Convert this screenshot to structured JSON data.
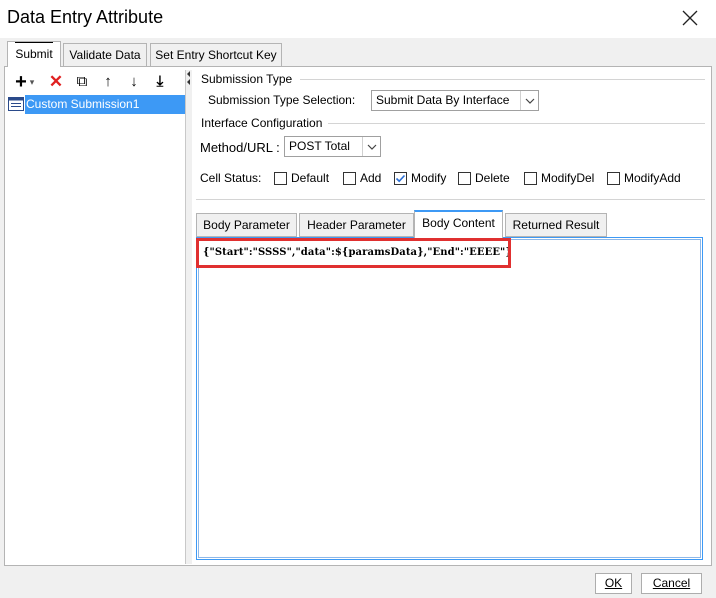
{
  "window": {
    "title": "Data Entry Attribute",
    "close_icon": "close-icon"
  },
  "top_tabs": [
    {
      "label": "Submit",
      "active": true
    },
    {
      "label": "Validate Data",
      "active": false
    },
    {
      "label": "Set Entry Shortcut Key",
      "active": false
    }
  ],
  "toolbar": {
    "add": "+",
    "add_dropdown": "▾",
    "delete": "✕",
    "copy": "⧉",
    "move_up": "↑",
    "move_down": "↓",
    "move_bottom": "⤓"
  },
  "tree": {
    "items": [
      {
        "label": "Custom Submission1",
        "selected": true
      }
    ]
  },
  "submission_type": {
    "section_label": "Submission Type",
    "selection_label": "Submission Type Selection:",
    "selection_value": "Submit Data By Interface"
  },
  "interface_config": {
    "section_label": "Interface Configuration",
    "method_label": "Method/URL :",
    "method_value": "POST Total"
  },
  "cell_status": {
    "label": "Cell Status:",
    "options": [
      {
        "label": "Default",
        "checked": false
      },
      {
        "label": "Add",
        "checked": false
      },
      {
        "label": "Modify",
        "checked": true
      },
      {
        "label": "Delete",
        "checked": false
      },
      {
        "label": "ModifyDel",
        "checked": false
      },
      {
        "label": "ModifyAdd",
        "checked": false
      }
    ]
  },
  "body_tabs": [
    {
      "label": "Body Parameter",
      "active": false
    },
    {
      "label": "Header Parameter",
      "active": false
    },
    {
      "label": "Body Content",
      "active": true
    },
    {
      "label": "Returned Result",
      "active": false
    }
  ],
  "body_content": {
    "text": "{\"Start\":\"SSSS\",\"data\":${paramsData},\"End\":\"EEEE\"}"
  },
  "footer": {
    "ok": "OK",
    "cancel": "Cancel"
  },
  "colors": {
    "accent": "#3d99f5",
    "highlight": "#e03030",
    "check": "#2b6fd6"
  }
}
